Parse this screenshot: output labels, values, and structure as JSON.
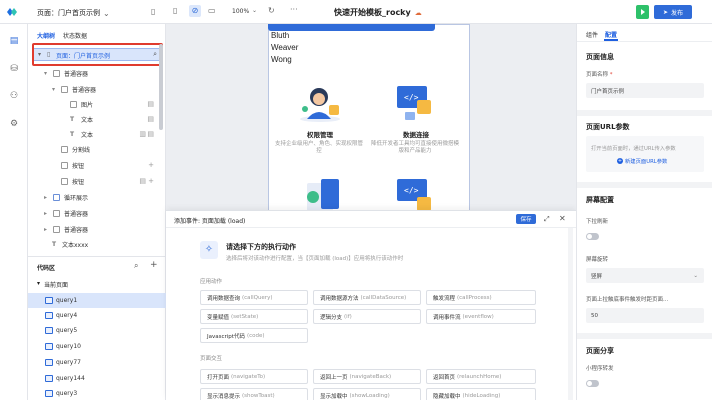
{
  "topbar": {
    "page_label": "页面：门户首页示例",
    "zoom": "100%",
    "title": "快速开始模板_rocky",
    "run_label": "▶",
    "publish_label": "发布"
  },
  "outline": {
    "tab_outline": "大纲树",
    "tab_state": "状态数据",
    "root_label": "页面：门户首页示例",
    "nodes": [
      {
        "label": "普通容器",
        "depth": 1
      },
      {
        "label": "普通容器",
        "depth": 2
      },
      {
        "label": "图片",
        "depth": 3
      },
      {
        "label": "文本",
        "depth": 3
      },
      {
        "label": "文本",
        "depth": 3
      },
      {
        "label": "分割线",
        "depth": 2
      },
      {
        "label": "按钮",
        "depth": 2
      },
      {
        "label": "按钮",
        "depth": 2
      },
      {
        "label": "循环展示",
        "depth": 1
      },
      {
        "label": "普通容器",
        "depth": 1
      },
      {
        "label": "普通容器",
        "depth": 1
      },
      {
        "label": "文本xxxx",
        "depth": 1
      }
    ]
  },
  "code": {
    "title": "代码区",
    "current_page": "当前页面",
    "queries": [
      "query1",
      "query4",
      "query5",
      "query10",
      "query77",
      "query144",
      "query3"
    ]
  },
  "canvas": {
    "names": [
      "Bluth",
      "Weaver",
      "Wong"
    ],
    "features": [
      {
        "title": "权限管理",
        "desc": "支持企业级用户、角色、实现权限管控"
      },
      {
        "title": "数据连接",
        "desc": "降低开发者工具均可直接使用微搭模版和产品能力"
      }
    ]
  },
  "drawer": {
    "title": "添加事件: 页面加载 (load)",
    "save_label": "保存",
    "action_title": "请选择下方的执行动作",
    "action_sub": "选择后将对该动作进行配置，当【页面加载 (load)】应用将执行该动作时",
    "section_app": "应用动作",
    "section_page": "页面交互",
    "app_actions": [
      {
        "label": "调用数据查询",
        "sub": "(callQuery)"
      },
      {
        "label": "调用数据源方法",
        "sub": "(callDataSource)"
      },
      {
        "label": "触发流程",
        "sub": "(callProcess)"
      },
      {
        "label": "变量赋值",
        "sub": "(setState)"
      },
      {
        "label": "逻辑分支",
        "sub": "(if)"
      },
      {
        "label": "调用事件流",
        "sub": "(eventflow)"
      },
      {
        "label": "Javascript代码",
        "sub": "(code)"
      }
    ],
    "page_actions": [
      {
        "label": "打开页面",
        "sub": "(navigateTo)"
      },
      {
        "label": "返回上一页",
        "sub": "(navigateBack)"
      },
      {
        "label": "返回首页",
        "sub": "(relaunchHome)"
      },
      {
        "label": "显示消息提示",
        "sub": "(showToast)"
      },
      {
        "label": "显示加载中",
        "sub": "(showLoading)"
      },
      {
        "label": "隐藏加载中",
        "sub": "(hideLoading)"
      }
    ]
  },
  "rightpanel": {
    "tab_component": "组件",
    "tab_config": "配置",
    "page_info": "页面信息",
    "page_name_label": "页面名称",
    "page_name_required": "*",
    "page_name_value": "门户首页示例",
    "url_params": "页面URL参数",
    "url_hint": "打开当前页面时，通过URL传入参数",
    "new_param": "新建页面URL参数",
    "screen_config": "屏幕配置",
    "pull_refresh": "下拉刷新",
    "rotate_label": "屏幕旋转",
    "rotate_value": "竖屏",
    "bottom_label": "页面上拉触底事件触发时距页面...",
    "bottom_value": "50",
    "share_head": "页面分享",
    "mini_forward": "小程序转发"
  }
}
